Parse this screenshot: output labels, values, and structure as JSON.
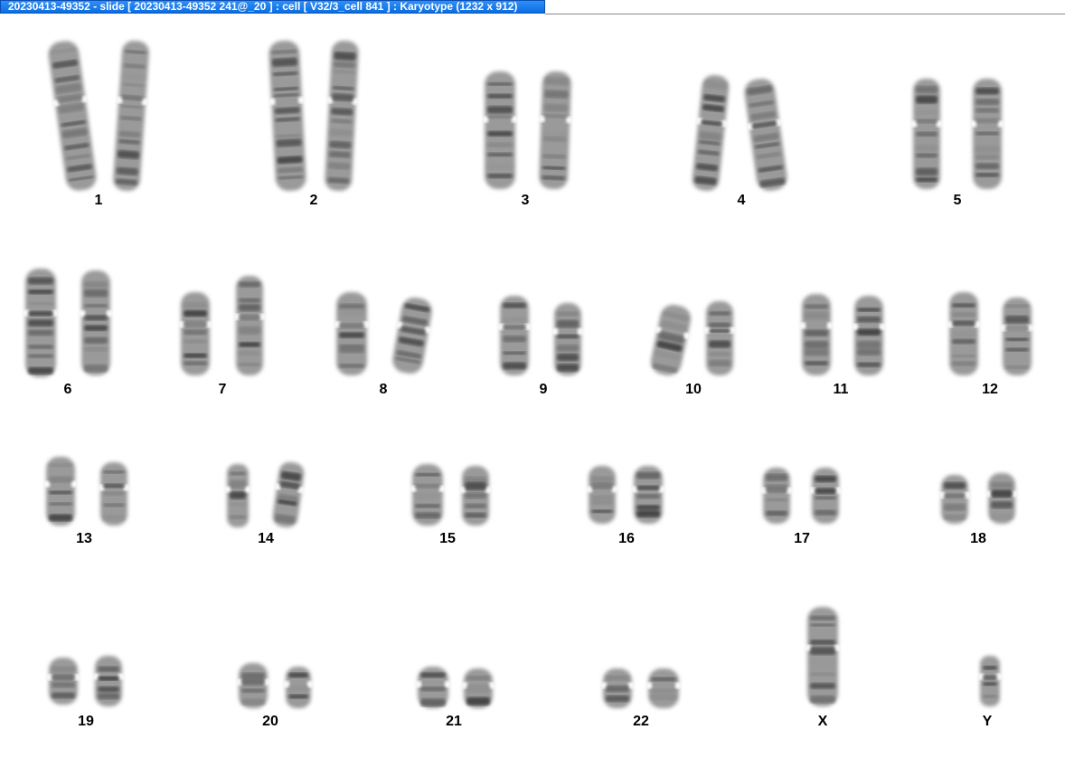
{
  "window": {
    "title": "20230413-49352 - slide [ 20230413-49352 241@_20 ] : cell [ V32/3_cell 841 ] : Karyotype  (1232 x 912)"
  },
  "karyotype": {
    "chromosomes": [
      {
        "label": "1"
      },
      {
        "label": "2"
      },
      {
        "label": "3"
      },
      {
        "label": "4"
      },
      {
        "label": "5"
      },
      {
        "label": "6"
      },
      {
        "label": "7"
      },
      {
        "label": "8"
      },
      {
        "label": "9"
      },
      {
        "label": "10"
      },
      {
        "label": "11"
      },
      {
        "label": "12"
      },
      {
        "label": "13"
      },
      {
        "label": "14"
      },
      {
        "label": "15"
      },
      {
        "label": "16"
      },
      {
        "label": "17"
      },
      {
        "label": "18"
      },
      {
        "label": "19"
      },
      {
        "label": "20"
      },
      {
        "label": "21"
      },
      {
        "label": "22"
      },
      {
        "label": "X"
      },
      {
        "label": "Y"
      }
    ]
  }
}
